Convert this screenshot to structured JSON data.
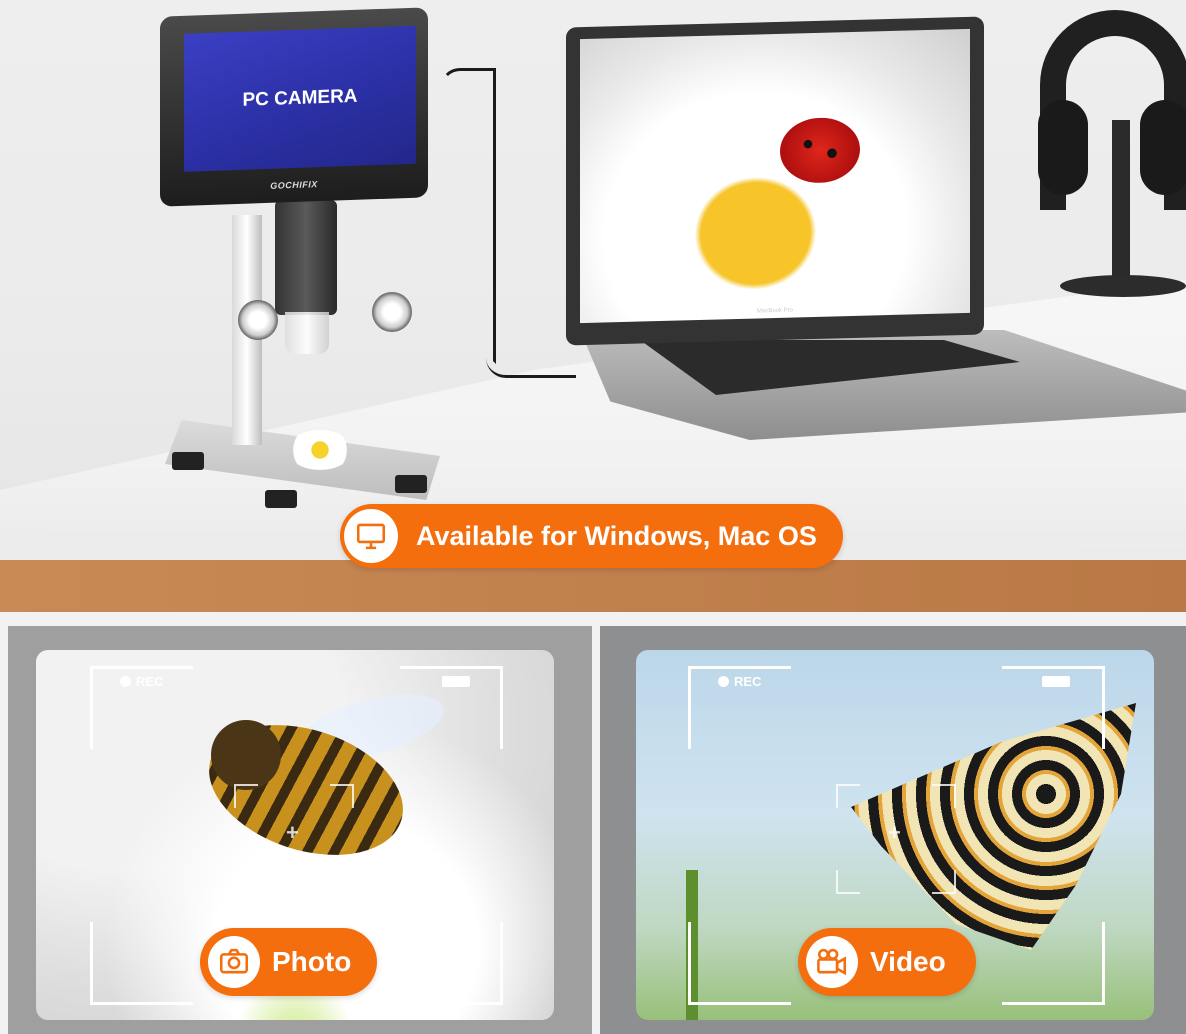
{
  "hero": {
    "monitor_text": "PC CAMERA",
    "monitor_brand": "GOCHIFIX",
    "laptop_label": "MacBook Pro",
    "banner_text": "Available for Windows, Mac OS",
    "banner_icon": "monitor-icon"
  },
  "panels": [
    {
      "rec_label": "REC",
      "button_label": "Photo",
      "button_icon": "camera-icon"
    },
    {
      "rec_label": "REC",
      "button_label": "Video",
      "button_icon": "video-camera-icon"
    }
  ],
  "colors": {
    "accent": "#f46e0e",
    "monitor_screen": "#2f33b3"
  }
}
